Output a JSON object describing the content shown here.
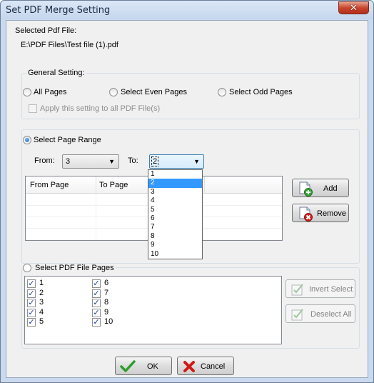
{
  "window": {
    "title": "Set PDF Merge Setting",
    "close_label": "✕"
  },
  "selected_file": {
    "label": "Selected Pdf File:",
    "path": "E:\\PDF Files\\Test file (1).pdf"
  },
  "general": {
    "title": "General Setting:",
    "all_pages": "All Pages",
    "even_pages": "Select Even Pages",
    "odd_pages": "Select Odd Pages",
    "apply_all": "Apply this setting to all PDF File(s)",
    "selected_option": "none"
  },
  "range": {
    "title": "Select Page Range",
    "selected": true,
    "from_label": "From:",
    "from_value": "3",
    "to_label": "To:",
    "to_value": "2",
    "to_options": [
      "1",
      "2",
      "3",
      "4",
      "5",
      "6",
      "7",
      "8",
      "9",
      "10"
    ],
    "to_highlighted": "2",
    "table_headers": [
      "From Page",
      "To Page"
    ],
    "add_label": "Add",
    "remove_label": "Remove"
  },
  "file_pages": {
    "title": "Select PDF File Pages",
    "selected": false,
    "pages_col1": [
      "1",
      "2",
      "3",
      "4",
      "5"
    ],
    "pages_col2": [
      "6",
      "7",
      "8",
      "9",
      "10"
    ],
    "invert_label": "Invert Select",
    "deselect_label": "Deselect All"
  },
  "footer": {
    "ok_label": "OK",
    "cancel_label": "Cancel"
  },
  "icons": [
    "close-icon",
    "dropdown-arrow-icon",
    "add-icon",
    "remove-icon",
    "invert-select-icon",
    "deselect-icon",
    "check-icon",
    "cancel-icon"
  ],
  "colors": {
    "titlebar": "#c9d9ee",
    "close_button": "#c8452d",
    "selection_highlight": "#3399ff",
    "ok_green": "#2f9e2f",
    "cancel_red": "#d01818",
    "add_green": "#3aa63a",
    "remove_red": "#d62020"
  }
}
